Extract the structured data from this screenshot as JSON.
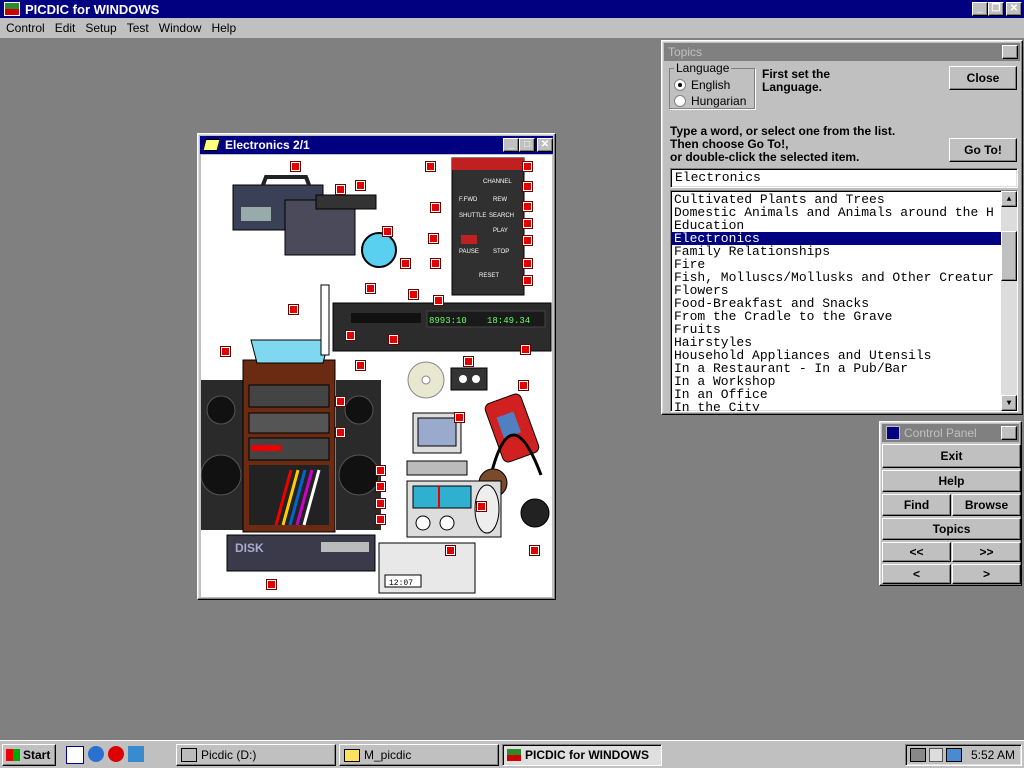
{
  "app": {
    "title": "PICDIC for WINDOWS"
  },
  "menu": [
    "Control",
    "Edit",
    "Setup",
    "Test",
    "Window",
    "Help"
  ],
  "electronics_window": {
    "title": "Electronics 2/1"
  },
  "topics": {
    "title": "Topics",
    "language_legend": "Language",
    "lang_english": "English",
    "lang_hungarian": "Hungarian",
    "first_set": "First set the Language.",
    "close": "Close",
    "instr1": "Type a word, or select one from the list.",
    "instr2": "Then choose Go To!,",
    "instr3": "or double-click the selected item.",
    "goto": "Go To!",
    "input_value": "Electronics",
    "items": [
      "Cultivated Plants and Trees",
      "Domestic Animals and Animals around the H",
      "Education",
      "Electronics",
      "Family Relationships",
      "Fire",
      "Fish, Molluscs/Mollusks and Other Creatur",
      "Flowers",
      "Food-Breakfast and Snacks",
      "From the Cradle to the Grave",
      "Fruits",
      "Hairstyles",
      "Household Appliances and Utensils",
      "In a Restaurant - In a Pub/Bar",
      "In a Workshop",
      "In an Office",
      "In the City"
    ],
    "selected_index": 3
  },
  "control_panel": {
    "title": "Control Panel",
    "exit": "Exit",
    "help": "Help",
    "find": "Find",
    "browse": "Browse",
    "topics": "Topics",
    "first": "<<",
    "last": ">>",
    "prev": "<",
    "next": ">"
  },
  "taskbar": {
    "start": "Start",
    "tasks": [
      "Picdic (D:)",
      "M_picdic",
      "PICDIC for WINDOWS"
    ],
    "clock": "5:52 AM"
  },
  "device_labels": {
    "channel": "CHANNEL",
    "ffwd": "F.FWD",
    "rew": "REW",
    "shuttle": "SHUTTLE",
    "search": "SEARCH",
    "play": "PLAY",
    "pause": "PAUSE",
    "stop": "STOP",
    "reset": "RESET",
    "vcr_counter": "8993:10",
    "vcr_time": "18:49.34",
    "cd_label": "DISK",
    "clock_radio": "12:07"
  },
  "colors": {
    "title_active": "#000080",
    "desktop": "#808080",
    "face": "#c0c0c0",
    "hotspot": "#e00000"
  }
}
